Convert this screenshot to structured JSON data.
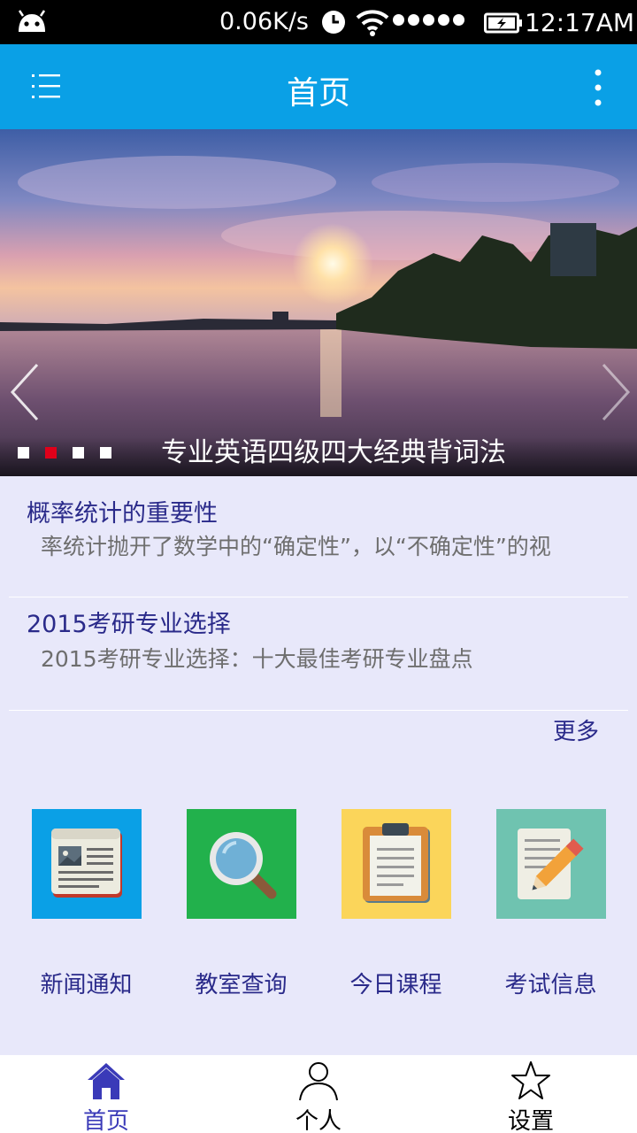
{
  "status_bar": {
    "net_speed": "0.06K/s",
    "time": "12:17AM",
    "icons": [
      "android-icon",
      "clock-icon",
      "wifi-icon",
      "signal-dots-icon",
      "battery-charging-icon"
    ]
  },
  "app_bar": {
    "title": "首页",
    "menu_icon": "menu-list-icon",
    "more_icon": "more-vertical-icon",
    "background": "#0aa0e6"
  },
  "banner": {
    "caption": "专业英语四级四大经典背词法",
    "slide_count": 4,
    "active_slide": 2,
    "active_dot_color": "#e0001a"
  },
  "news": {
    "items": [
      {
        "title": "概率统计的重要性",
        "summary": "率统计抛开了数学中的“确定性”，以“不确定性”的视"
      },
      {
        "title": "2015考研专业选择",
        "summary": "2015考研专业选择：十大最佳考研专业盘点"
      }
    ],
    "more_label": "更多"
  },
  "shortcuts": [
    {
      "label": "新闻通知",
      "icon": "newspaper-icon",
      "color": "#0aa0e6"
    },
    {
      "label": "教室查询",
      "icon": "magnifier-icon",
      "color": "#22b14c"
    },
    {
      "label": "今日课程",
      "icon": "clipboard-icon",
      "color": "#fbd55a"
    },
    {
      "label": "考试信息",
      "icon": "pencil-note-icon",
      "color": "#6fc3b0"
    }
  ],
  "bottom_nav": {
    "items": [
      {
        "label": "首页",
        "icon": "home-icon",
        "active": true
      },
      {
        "label": "个人",
        "icon": "person-icon",
        "active": false
      },
      {
        "label": "设置",
        "icon": "star-icon",
        "active": false
      }
    ],
    "active_color": "#3a3ab8"
  }
}
